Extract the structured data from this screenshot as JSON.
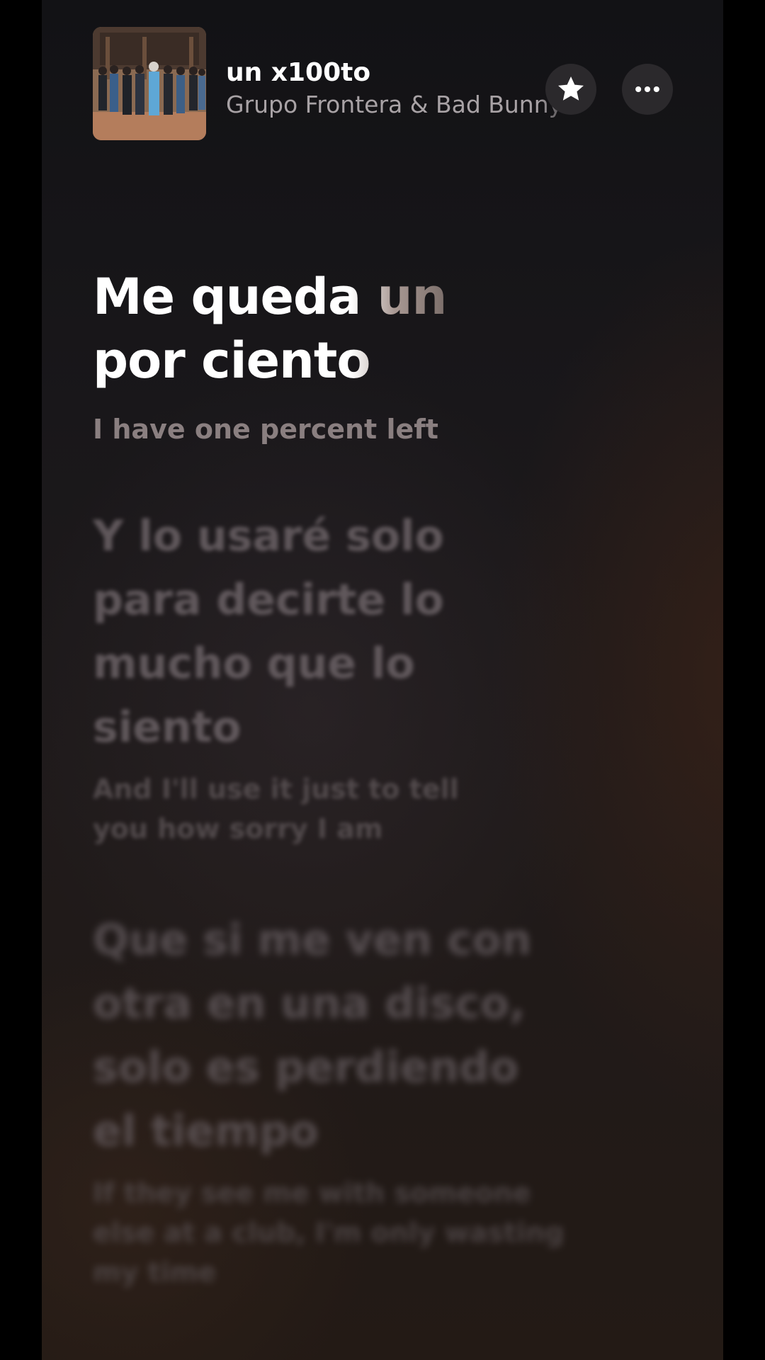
{
  "now_playing": {
    "title": "un x100to",
    "artist": "Grupo Frontera & Bad Bunny"
  },
  "actions": {
    "favorite_icon": "star-icon",
    "more_icon": "ellipsis-icon"
  },
  "lyrics": {
    "active": {
      "line": "Me queda un por ciento",
      "translation": "I have one percent left"
    },
    "upcoming": [
      {
        "line": "Y lo usaré solo para decirte lo mucho que lo siento",
        "translation": "And I'll use it just to tell you how sorry I am"
      },
      {
        "line": "Que si me ven con otra en una disco, solo es perdiendo el tiempo",
        "translation": "If they see me with someone else at a club, I'm only wasting my time"
      }
    ]
  }
}
